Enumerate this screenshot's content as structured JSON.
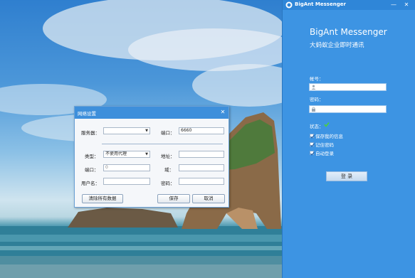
{
  "messenger": {
    "window_title": "BigAnt Messenger",
    "brand_title": "BigAnt Messenger",
    "brand_subtitle": "大蚂蚁企业即时通讯",
    "account_label": "帐号：",
    "account_value": "",
    "password_label": "密码：",
    "password_value": "",
    "status_label": "状态：",
    "status_color": "#4cd137",
    "checkboxes": [
      {
        "label": "保存我的信息",
        "checked": true
      },
      {
        "label": "记住密码",
        "checked": true
      },
      {
        "label": "自动登录",
        "checked": true
      }
    ],
    "login_label": "登  录",
    "min_icon": "minimize-icon",
    "close_icon": "close-icon"
  },
  "dialog": {
    "title": "网络设置",
    "close_glyph": "✕",
    "server_label": "服务器：",
    "server_value": "",
    "port_label": "端口：",
    "port_value": "6660",
    "type_label": "类型：",
    "type_value": "不使用代理",
    "address_label": "地址：",
    "address_value": "",
    "proxy_port_label": "端口：",
    "proxy_port_value": "0",
    "domain_label": "域：",
    "domain_value": "",
    "username_label": "用户名：",
    "username_value": "",
    "proxy_password_label": "密码：",
    "proxy_password_value": "",
    "clear_button": "清除所有数据",
    "save_button": "保存",
    "cancel_button": "取消"
  },
  "colors": {
    "panel_bg": "#3d94e3",
    "dialog_title_bg": "#3e8fdb"
  }
}
